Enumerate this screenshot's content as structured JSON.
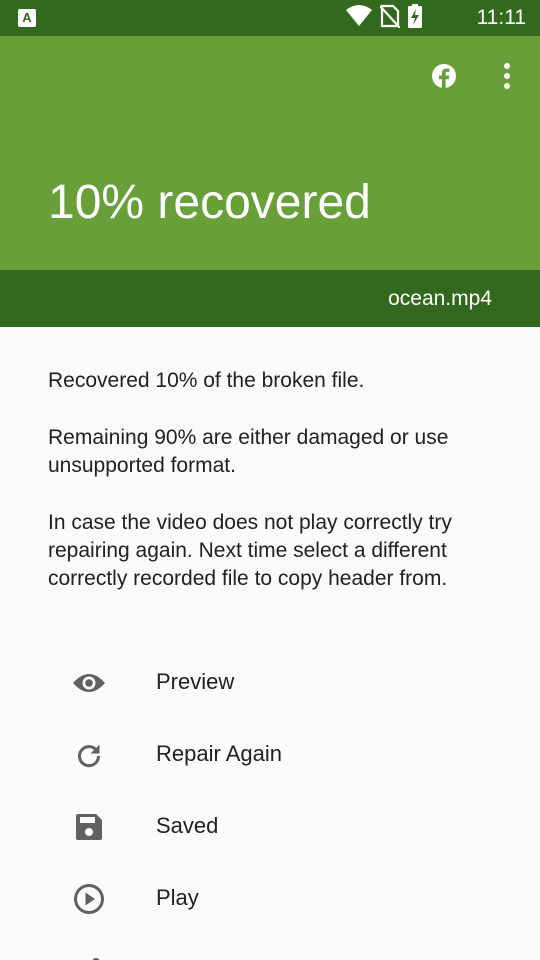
{
  "status_bar": {
    "app_icon_letter": "A",
    "time": "11:11"
  },
  "header": {
    "title": "10% recovered",
    "progress_percent": 10,
    "file_name": "ocean.mp4"
  },
  "body": {
    "paragraphs": [
      "Recovered 10% of the broken file.",
      "Remaining 90% are either damaged or use unsupported format.",
      "In case the video does not play correctly try repairing again. Next time select a different correctly recorded file to copy header from."
    ]
  },
  "actions": [
    {
      "label": "Preview",
      "icon": "eye-icon"
    },
    {
      "label": "Repair Again",
      "icon": "refresh-icon"
    },
    {
      "label": "Saved",
      "icon": "save-icon"
    },
    {
      "label": "Play",
      "icon": "play-circle-icon"
    },
    {
      "label": "",
      "icon": "share-icon"
    }
  ],
  "colors": {
    "status_bar": "#33691e",
    "header": "#689f38",
    "file_bar": "#33691e",
    "icon": "#616161",
    "text": "#212121"
  }
}
